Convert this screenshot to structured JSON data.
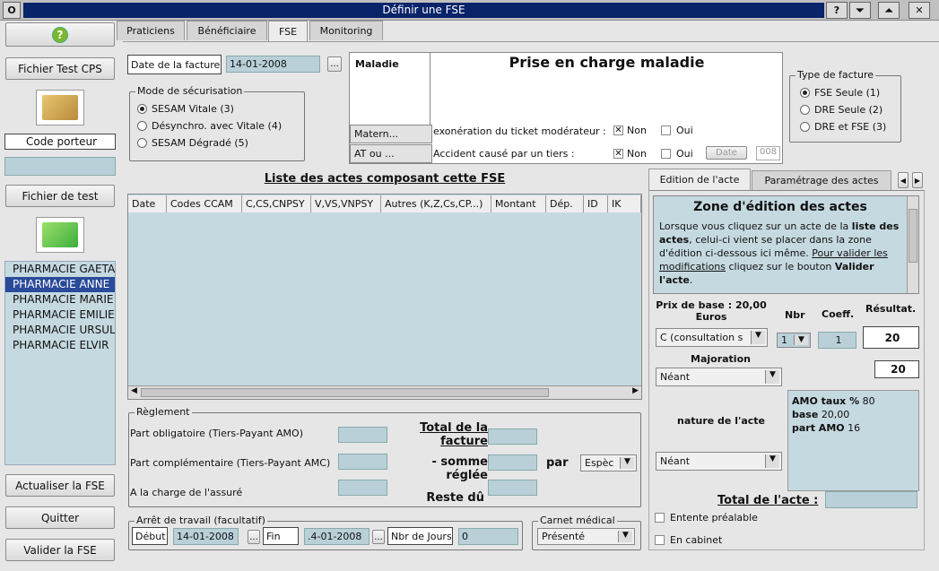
{
  "window": {
    "title": "Définir une FSE",
    "menu_btn": "O",
    "help_btn": "?",
    "min_btn": "⏷",
    "max_btn": "⏶",
    "close_btn": "✕"
  },
  "sidebar": {
    "help_icon": "?",
    "test_cps_btn": "Fichier Test CPS",
    "code_porteur": "Code porteur",
    "fichier_test_btn": "Fichier de test",
    "pharmacies": [
      "PHARMACIE GAETA",
      "PHARMACIE ANNE",
      "PHARMACIE MARIE",
      "PHARMACIE EMILIE",
      "PHARMACIE URSUL",
      "PHARMACIE ELVIR"
    ],
    "actualiser": "Actualiser la FSE",
    "quitter": "Quitter",
    "valider": "Valider la FSE"
  },
  "tabs": [
    "Praticiens",
    "Bénéficiaire",
    "FSE",
    "Monitoring"
  ],
  "facture": {
    "date_label": "Date de la facture",
    "date_value": "14-01-2008",
    "ellipsis": "..."
  },
  "securisation": {
    "legend": "Mode de sécurisation",
    "options": [
      "SESAM Vitale (3)",
      "Désynchro. avec Vitale (4)",
      "SESAM Dégradé (5)"
    ]
  },
  "maladie": {
    "tabs": [
      "Maladie",
      "Matern...",
      "AT ou ..."
    ],
    "title": "Prise en charge maladie",
    "exo_label": "exonération du ticket modérateur :",
    "accident_label": "Accident causé par un tiers :",
    "non": "Non",
    "oui": "Oui",
    "date_btn": "Date",
    "date_val": "008"
  },
  "type_facture": {
    "legend": "Type de facture",
    "options": [
      "FSE Seule (1)",
      "DRE Seule (2)",
      "DRE et FSE (3)"
    ]
  },
  "actes": {
    "title": "Liste des actes composant cette FSE",
    "columns": [
      "Date",
      "Codes CCAM",
      "C,CS,CNPSY",
      "V,VS,VNPSY",
      "Autres (K,Z,Cs,CP...)",
      "Montant",
      "Dép.",
      "ID",
      "IK (nb"
    ]
  },
  "reglement": {
    "legend": "Règlement",
    "part_obl": "Part obligatoire (Tiers-Payant AMO)",
    "part_comp": "Part complémentaire (Tiers-Payant AMC)",
    "charge": "A la charge de l'assuré",
    "total_l1": "Total de la",
    "total_l2": "facture",
    "somme_l1": "- somme",
    "somme_l2": "réglée",
    "reste": "Reste dû",
    "par": "par",
    "mode": "Espèc"
  },
  "arret": {
    "legend": "Arrêt de travail (facultatif)",
    "debut": "Début",
    "debut_val": "14-01-2008",
    "fin": "Fin",
    "fin_val": ".4-01-2008",
    "nbr": "Nbr de Jours",
    "nbr_val": "0",
    "ellipsis": "..."
  },
  "carnet": {
    "legend": "Carnet médical",
    "value": "Présenté"
  },
  "edition": {
    "tabs": [
      "Edition de l'acte",
      "Paramétrage des actes"
    ],
    "zone_title": "Zone d'édition des actes",
    "zone_t1": "Lorsque vous cliquez sur un acte de la ",
    "zone_b1": "liste des actes",
    "zone_t2": ", celui-ci vient se placer dans la zone d'édition ci-dessous ici même.",
    "zone_u": "Pour valider les modifications",
    "zone_t3": " cliquez sur le bouton ",
    "zone_b2": "Valider l'acte",
    "zone_t4": ".",
    "prix_l1": "Prix de base : 20,00",
    "prix_l2": "Euros",
    "nbr": "Nbr",
    "coeff": "Coeff.",
    "resultat": "Résultat.",
    "acte_sel": "C (consultation s",
    "nbr_val": "1",
    "coeff_val": "1",
    "res_val": "20",
    "majoration": "Majoration",
    "maj_sel": "Néant",
    "maj_val": "20",
    "nature": "nature de l'acte",
    "nature_sel": "Néant",
    "amo_label": "AMO taux %",
    "amo_val": "80",
    "base_label": "base",
    "base_val": "20,00",
    "part_label": "part AMO",
    "part_val": "16",
    "total_acte": "Total de l'acte :",
    "entente": "Entente préalable",
    "cabinet": "En cabinet"
  }
}
